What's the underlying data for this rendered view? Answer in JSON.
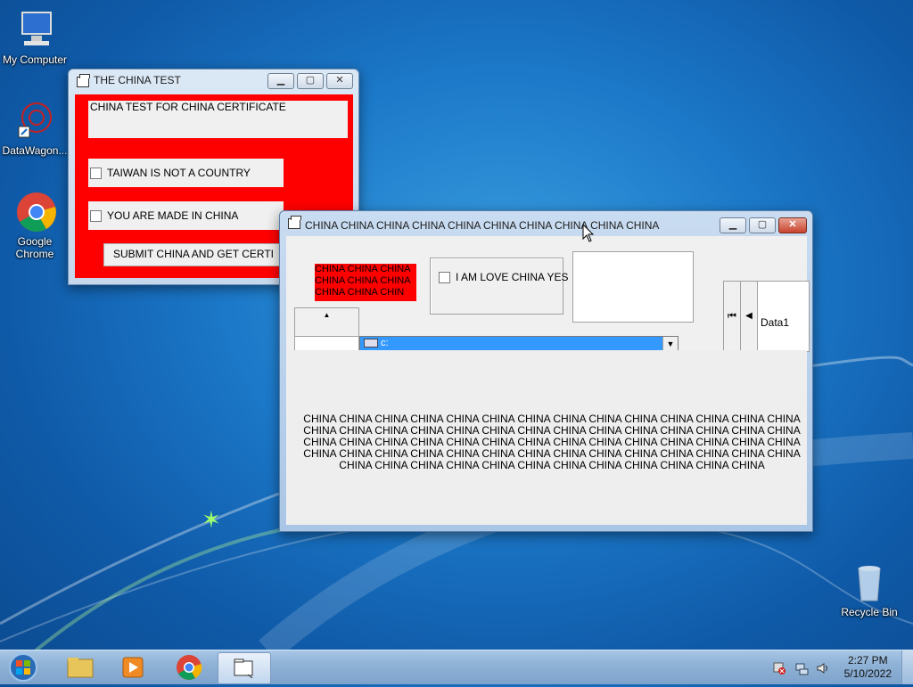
{
  "desktop": {
    "icons": [
      {
        "label": "My Computer"
      },
      {
        "label": "DataWagon..."
      },
      {
        "label": "Google Chrome"
      },
      {
        "label": "Recycle Bin"
      }
    ]
  },
  "window1": {
    "title": "THE CHINA TEST",
    "header_label": "CHINA TEST FOR CHINA CERTIFICATE",
    "checkbox1": "TAIWAN IS NOT A COUNTRY",
    "checkbox2": "YOU ARE MADE IN CHINA",
    "submit_label": "SUBMIT CHINA AND GET CERTI",
    "bg_color": "#ff0000"
  },
  "window2": {
    "title": "CHINA CHINA CHINA CHINA CHINA CHINA CHINA CHINA CHINA CHINA",
    "red_label": "CHINA CHINA CHINA CHINA CHINA CHINA CHINA CHINA CHIN",
    "checkbox": "I AM LOVE CHINA YES",
    "drive_value": "c:",
    "data_caption": "Data1",
    "big_text": "CHINA CHINA CHINA CHINA CHINA CHINA CHINA CHINA CHINA CHINA CHINA CHINA CHINA CHINA CHINA CHINA CHINA CHINA CHINA CHINA CHINA CHINA CHINA CHINA CHINA CHINA CHINA CHINA CHINA CHINA CHINA CHINA CHINA CHINA CHINA CHINA CHINA CHINA CHINA CHINA CHINA CHINA CHINA CHINA CHINA CHINA CHINA CHINA CHINA CHINA CHINA CHINA CHINA CHINA CHINA CHINA CHINA CHINA CHINA CHINA CHINA CHINA CHINA CHINA CHINA CHINA CHINA CHINA"
  },
  "taskbar": {
    "time": "2:27 PM",
    "date": "5/10/2022"
  },
  "colors": {
    "accent": "#3399ff",
    "red": "#ff0000"
  }
}
